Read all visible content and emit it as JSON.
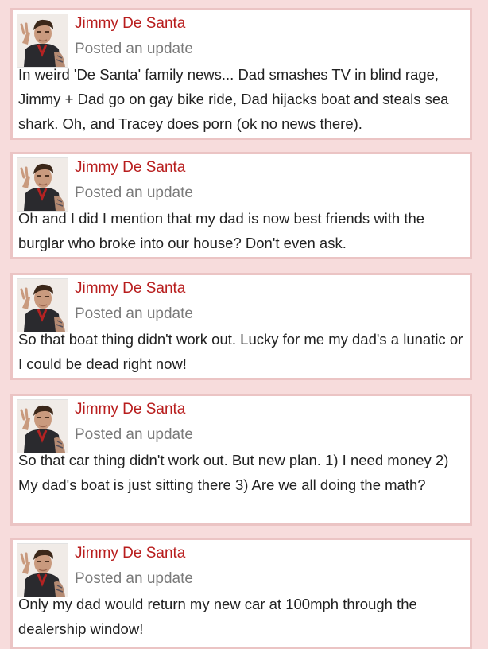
{
  "posts": [
    {
      "author": "Jimmy De Santa",
      "action": "Posted an update",
      "text": "In weird 'De Santa' family news... Dad smashes TV in blind rage, Jimmy + Dad go on gay bike ride, Dad hijacks boat and steals sea shark. Oh, and Tracey does porn (ok no news there)."
    },
    {
      "author": "Jimmy De Santa",
      "action": "Posted an update",
      "text": "Oh and I did I mention that my dad is now best friends with the burglar who broke into our house? Don't even ask."
    },
    {
      "author": "Jimmy De Santa",
      "action": "Posted an update",
      "text": "So that boat thing didn't work out. Lucky for me my dad's a lunatic or I could be dead right now!"
    },
    {
      "author": "Jimmy De Santa",
      "action": "Posted an update",
      "text": "So that car thing didn't work out. But new plan. 1) I need money 2) My dad's boat is just sitting there 3) Are we all doing the math?"
    },
    {
      "author": "Jimmy De Santa",
      "action": "Posted an update",
      "text": "Only my dad would return my new car at 100mph through the dealership window!"
    }
  ],
  "colors": {
    "page_background": "#f7dcdc",
    "card_border": "#ebc4c4",
    "author_name": "#b81d1d",
    "action_text": "#7a7a7a",
    "body_text": "#222222"
  }
}
